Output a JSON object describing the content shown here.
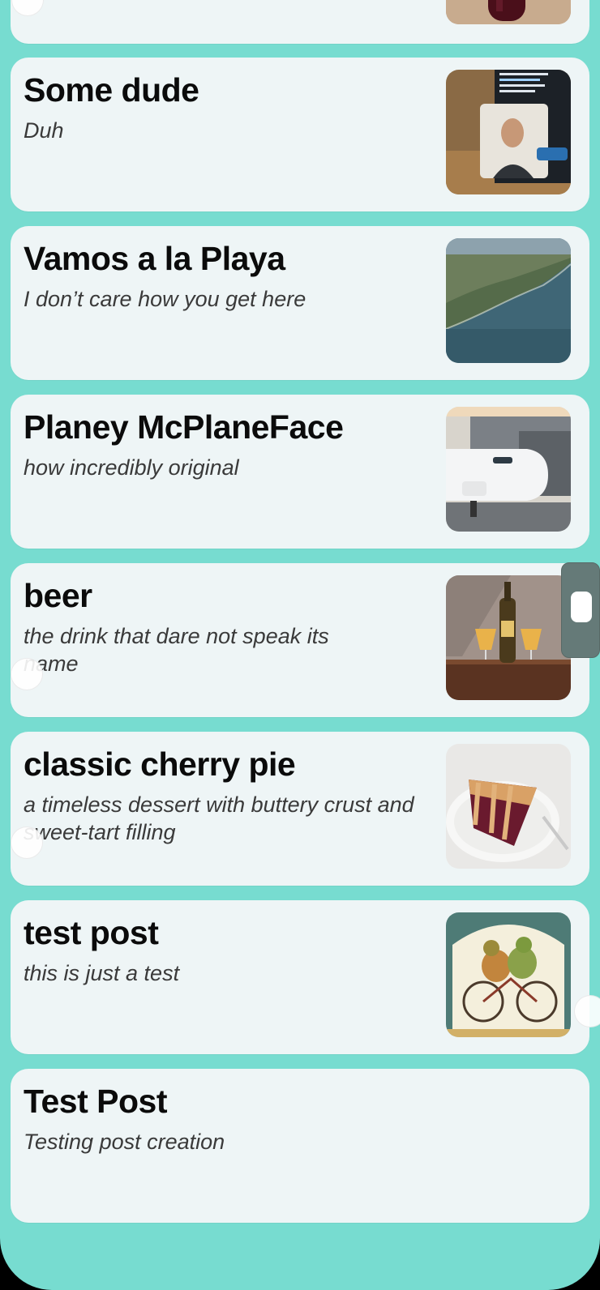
{
  "posts": [
    {
      "title": "",
      "subtitle": "",
      "image": "wine-bottle-photo"
    },
    {
      "title": "Some dude",
      "subtitle": "Duh",
      "image": "man-on-laptop-screen-photo"
    },
    {
      "title": "Vamos a la Playa",
      "subtitle": "I don’t care how you get here",
      "image": "coastline-aerial-photo"
    },
    {
      "title": "Planey McPlaneFace",
      "subtitle": "how incredibly original",
      "image": "airplane-at-gate-photo"
    },
    {
      "title": "beer",
      "subtitle": "the drink that dare not speak its name",
      "image": "beer-bottle-and-glasses-photo"
    },
    {
      "title": "classic cherry pie",
      "subtitle": "a timeless dessert with buttery crust and sweet-tart filling",
      "image": "cherry-pie-slice-photo"
    },
    {
      "title": "test post",
      "subtitle": "this is just a test",
      "image": "frogs-on-bicycle-illustration"
    },
    {
      "title": "Test Post",
      "subtitle": "Testing post creation",
      "image": null
    }
  ],
  "colors": {
    "background": "#77DCD0",
    "card": "#EEF5F6",
    "title": "#0B0B0B",
    "subtitle": "#3A3A3A"
  },
  "scrollbar": {
    "visible": true
  }
}
